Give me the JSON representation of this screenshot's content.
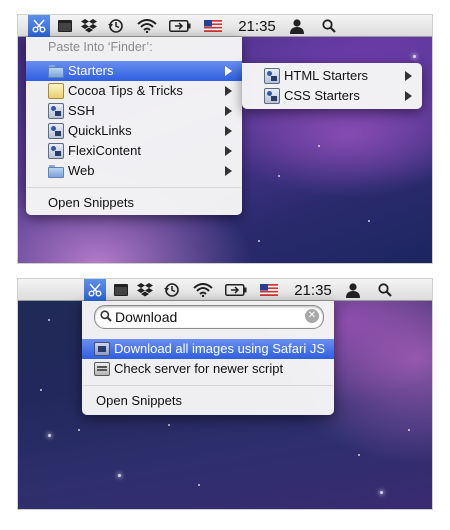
{
  "menubar": {
    "clock": "21:35",
    "icons": [
      "scissors-icon",
      "window-icon",
      "dropbox-icon",
      "time-machine-icon",
      "wifi-icon",
      "battery-icon",
      "us-flag-icon",
      "user-icon",
      "spotlight-icon"
    ],
    "accent": "#3a6ee0"
  },
  "top_menu": {
    "header": "Paste Into ‘Finder’:",
    "items": [
      {
        "label": "Starters",
        "icon": "folder-icon",
        "has_submenu": true,
        "selected": true
      },
      {
        "label": "Cocoa Tips & Tricks",
        "icon": "document-icon",
        "has_submenu": true
      },
      {
        "label": "SSH",
        "icon": "snippet-icon",
        "has_submenu": true
      },
      {
        "label": "QuickLinks",
        "icon": "snippet-icon",
        "has_submenu": true
      },
      {
        "label": "FlexiContent",
        "icon": "snippet-icon",
        "has_submenu": true
      },
      {
        "label": "Web",
        "icon": "folder-icon",
        "has_submenu": true
      }
    ],
    "footer": "Open Snippets"
  },
  "submenu": {
    "items": [
      {
        "label": "HTML Starters",
        "icon": "snippet-icon",
        "has_submenu": true
      },
      {
        "label": "CSS Starters",
        "icon": "snippet-icon",
        "has_submenu": true
      }
    ]
  },
  "bottom_menu": {
    "search_value": "Download",
    "results": [
      {
        "label": "Download all images using Safari  JS",
        "icon": "script-icon",
        "selected": true
      },
      {
        "label": "Check server for newer script",
        "icon": "script-icon"
      }
    ],
    "footer": "Open Snippets"
  }
}
